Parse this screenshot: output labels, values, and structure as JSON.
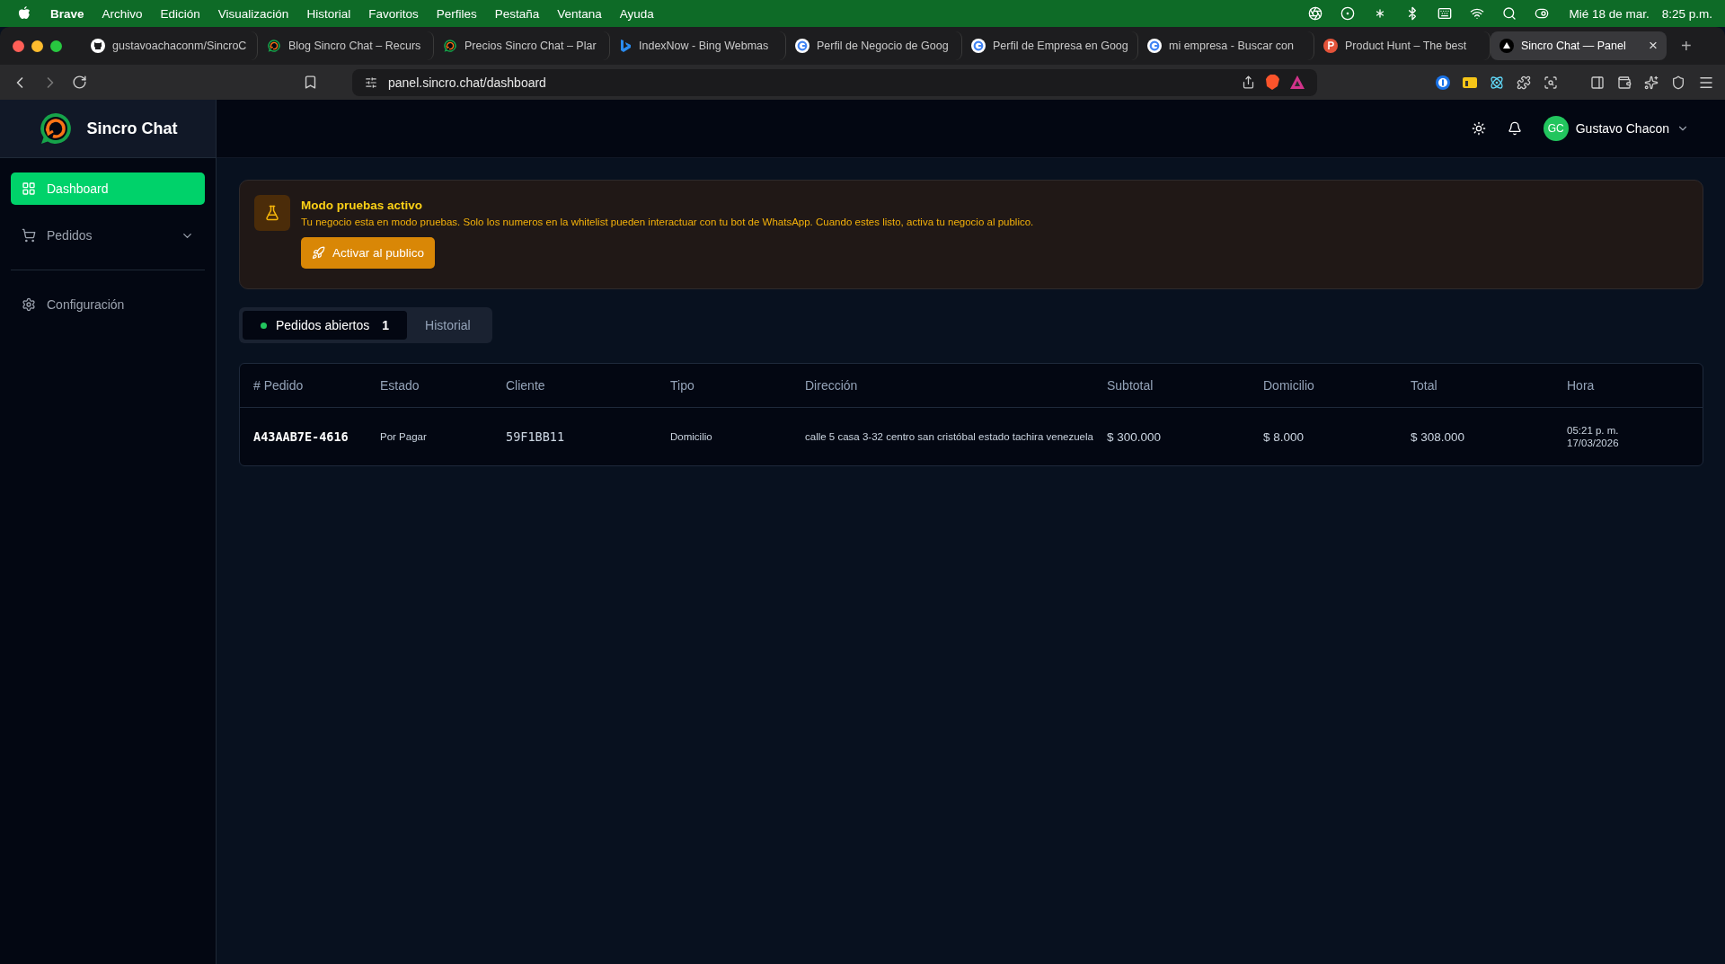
{
  "menu_bar": {
    "items": [
      {
        "label": "Brave",
        "bold": true
      },
      {
        "label": "Archivo",
        "bold": false
      },
      {
        "label": "Edición",
        "bold": false
      },
      {
        "label": "Visualización",
        "bold": false
      },
      {
        "label": "Historial",
        "bold": false
      },
      {
        "label": "Favoritos",
        "bold": false
      },
      {
        "label": "Perfiles",
        "bold": false
      },
      {
        "label": "Pestaña",
        "bold": false
      },
      {
        "label": "Ventana",
        "bold": false
      },
      {
        "label": "Ayuda",
        "bold": false
      }
    ],
    "date": "Mié 18 de mar.",
    "time": "8:25 p.m."
  },
  "browser": {
    "tabs": [
      {
        "title": "gustavoachaconm/SincroC",
        "kind": "github",
        "selected": false
      },
      {
        "title": "Blog Sincro Chat – Recurs",
        "kind": "sincro",
        "selected": false
      },
      {
        "title": "Precios Sincro Chat – Plar",
        "kind": "sincro",
        "selected": false
      },
      {
        "title": "IndexNow - Bing Webmas",
        "kind": "bing",
        "selected": false
      },
      {
        "title": "Perfil de Negocio de Goog",
        "kind": "google",
        "selected": false
      },
      {
        "title": "Perfil de Empresa en Goog",
        "kind": "google",
        "selected": false
      },
      {
        "title": "mi empresa - Buscar con",
        "kind": "google",
        "selected": false
      },
      {
        "title": "Product Hunt – The best",
        "kind": "producthunt",
        "selected": false
      },
      {
        "title": "Sincro Chat — Panel",
        "kind": "panel",
        "selected": true
      }
    ],
    "close": "×",
    "new_tab": "+",
    "address": "panel.sincro.chat/dashboard"
  },
  "sidebar": {
    "brand": "Sincro Chat",
    "sections": [
      [
        {
          "label": "Dashboard",
          "selected": true,
          "expandable": false
        },
        {
          "label": "Pedidos",
          "selected": false,
          "expandable": true
        }
      ],
      [
        {
          "label": "Configuración",
          "selected": false,
          "expandable": false
        }
      ]
    ]
  },
  "header": {
    "user": {
      "initials": "GC",
      "name": "Gustavo Chacon"
    }
  },
  "notice": {
    "title": "Modo pruebas activo",
    "message": "Tu negocio esta en modo pruebas. Solo los numeros en la whitelist pueden interactuar con tu bot de WhatsApp. Cuando estes listo, activa tu negocio al publico.",
    "button": "Activar al publico"
  },
  "order_tabs": [
    {
      "label": "Pedidos abiertos",
      "count": "1",
      "selected": true
    },
    {
      "label": "Historial",
      "selected": false
    }
  ],
  "table": {
    "columns": [
      "# Pedido",
      "Estado",
      "Cliente",
      "Tipo",
      "Dirección",
      "Subtotal",
      "Domicilio",
      "Total",
      "Hora"
    ],
    "rows": [
      {
        "order": "A43AAB7E-4616",
        "status": "Por Pagar",
        "client": "59F1BB11",
        "type": "Domicilio",
        "address": "calle 5 casa 3-32 centro san cristóbal estado tachira venezuela",
        "subtotal": "$ 300.000",
        "delivery": "$ 8.000",
        "total": "$ 308.000",
        "time": "05:21 p. m.",
        "date": "17/03/2026"
      }
    ]
  }
}
